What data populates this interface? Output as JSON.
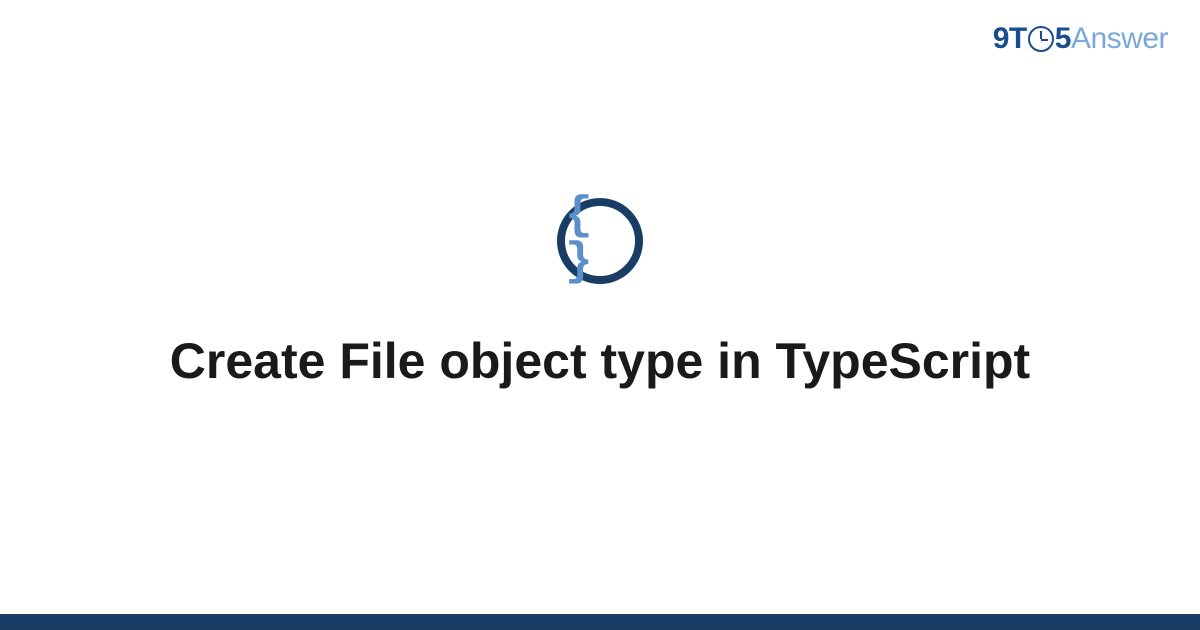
{
  "logo": {
    "part1": "9T",
    "part2": "5",
    "part3": "Answer"
  },
  "icon": {
    "name": "code-braces-icon",
    "glyph": "{ }"
  },
  "title": "Create File object type in TypeScript",
  "colors": {
    "accent_dark": "#1a3d66",
    "accent_blue": "#1a4d8f",
    "accent_light": "#7ba7d9",
    "brace_blue": "#5a8fc9"
  }
}
